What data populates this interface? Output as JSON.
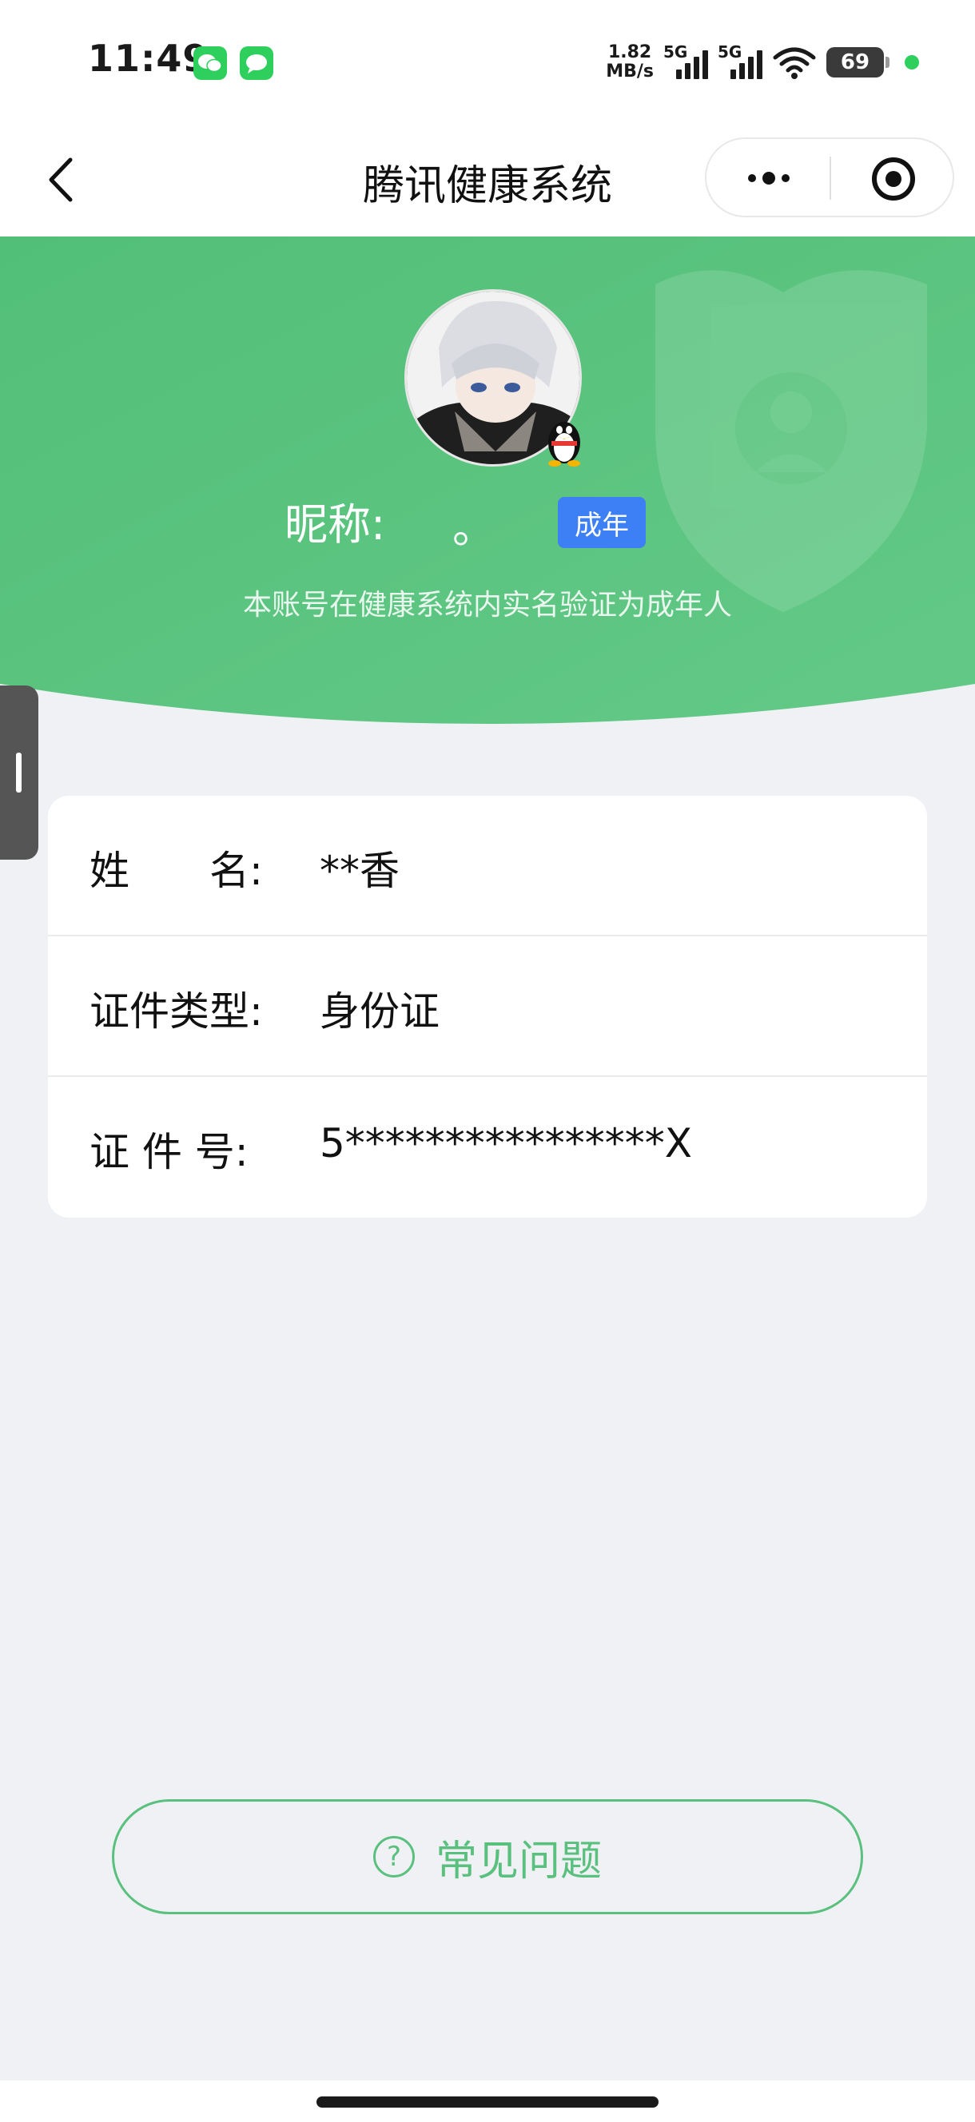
{
  "status_bar": {
    "time": "11:49",
    "net_speed_value": "1.82",
    "net_speed_unit": "MB/s",
    "signal1_label": "5G",
    "signal2_label": "5G",
    "battery": "69",
    "icons": [
      "wechat-icon",
      "messages-icon",
      "wifi-icon",
      "battery-icon"
    ]
  },
  "navbar": {
    "title": "腾讯健康系统"
  },
  "profile": {
    "nickname_label": "昵称:",
    "nickname_value": "。",
    "badge": "成年",
    "description": "本账号在健康系统内实名验证为成年人"
  },
  "info": {
    "rows": [
      {
        "label": "姓　　名:",
        "value": "**香"
      },
      {
        "label": "证件类型:",
        "value": "身份证"
      },
      {
        "label": "证 件 号:",
        "value": "5****************X"
      }
    ]
  },
  "faq": {
    "icon": "?",
    "label": "常见问题"
  },
  "colors": {
    "brand_green": "#5ac07e",
    "badge_blue": "#3d7ff5",
    "page_bg": "#f0f1f5"
  }
}
